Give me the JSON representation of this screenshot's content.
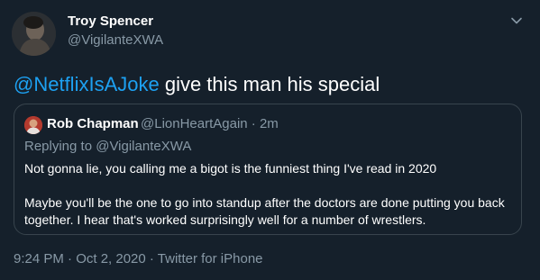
{
  "tweet": {
    "author": {
      "name": "Troy Spencer",
      "handle": "@VigilanteXWA"
    },
    "text": {
      "mention": "@NetflixIsAJoke",
      "body": " give this man his special"
    },
    "timestamp": "9:24 PM · Oct 2, 2020 · Twitter for iPhone"
  },
  "quoted": {
    "author": {
      "name": "Rob Chapman",
      "handle": "@LionHeartAgain · 2m"
    },
    "replying_to": "Replying to @VigilanteXWA",
    "paragraphs": [
      "Not gonna lie, you calling me a bigot is the funniest thing I've read in 2020",
      "Maybe you'll be the one to go into standup after the doctors are done putting you back together. I hear that's worked surprisingly well for a number of wrestlers."
    ]
  },
  "colors": {
    "background": "#15202b",
    "accent": "#1da1f2",
    "muted": "#8899a6",
    "border": "#38444d"
  },
  "icons": {
    "menu": "chevron-down-icon"
  }
}
